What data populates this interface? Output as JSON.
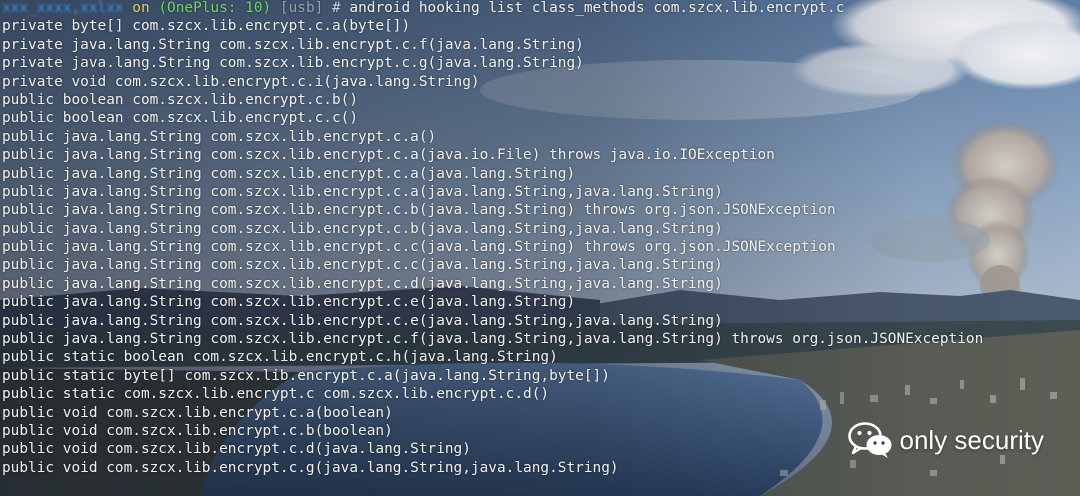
{
  "prompt": {
    "user": "xxx_xxxx,xxlxx",
    "on": "on",
    "device": "(OnePlus: 10)",
    "usb": "[usb]",
    "hash": "#",
    "command": "android hooking list class_methods com.szcx.lib.encrypt.c"
  },
  "methods": [
    "private byte[] com.szcx.lib.encrypt.c.a(byte[])",
    "private java.lang.String com.szcx.lib.encrypt.c.f(java.lang.String)",
    "private java.lang.String com.szcx.lib.encrypt.c.g(java.lang.String)",
    "private void com.szcx.lib.encrypt.c.i(java.lang.String)",
    "public boolean com.szcx.lib.encrypt.c.b()",
    "public boolean com.szcx.lib.encrypt.c.c()",
    "public java.lang.String com.szcx.lib.encrypt.c.a()",
    "public java.lang.String com.szcx.lib.encrypt.c.a(java.io.File) throws java.io.IOException",
    "public java.lang.String com.szcx.lib.encrypt.c.a(java.lang.String)",
    "public java.lang.String com.szcx.lib.encrypt.c.a(java.lang.String,java.lang.String)",
    "public java.lang.String com.szcx.lib.encrypt.c.b(java.lang.String) throws org.json.JSONException",
    "public java.lang.String com.szcx.lib.encrypt.c.b(java.lang.String,java.lang.String)",
    "public java.lang.String com.szcx.lib.encrypt.c.c(java.lang.String) throws org.json.JSONException",
    "public java.lang.String com.szcx.lib.encrypt.c.c(java.lang.String,java.lang.String)",
    "public java.lang.String com.szcx.lib.encrypt.c.d(java.lang.String,java.lang.String)",
    "public java.lang.String com.szcx.lib.encrypt.c.e(java.lang.String)",
    "public java.lang.String com.szcx.lib.encrypt.c.e(java.lang.String,java.lang.String)",
    "public java.lang.String com.szcx.lib.encrypt.c.f(java.lang.String,java.lang.String) throws org.json.JSONException",
    "public static boolean com.szcx.lib.encrypt.c.h(java.lang.String)",
    "public static byte[] com.szcx.lib.encrypt.c.a(java.lang.String,byte[])",
    "public static com.szcx.lib.encrypt.c com.szcx.lib.encrypt.c.d()",
    "public void com.szcx.lib.encrypt.c.a(boolean)",
    "public void com.szcx.lib.encrypt.c.b(boolean)",
    "public void com.szcx.lib.encrypt.c.d(java.lang.String)",
    "public void com.szcx.lib.encrypt.c.g(java.lang.String,java.lang.String)"
  ],
  "watermark": {
    "text": "only security",
    "icon": "wechat-icon"
  },
  "colors": {
    "prompt_user": "#4aa3ff",
    "prompt_device": "#6fd86a",
    "text": "#f2f2f2"
  }
}
